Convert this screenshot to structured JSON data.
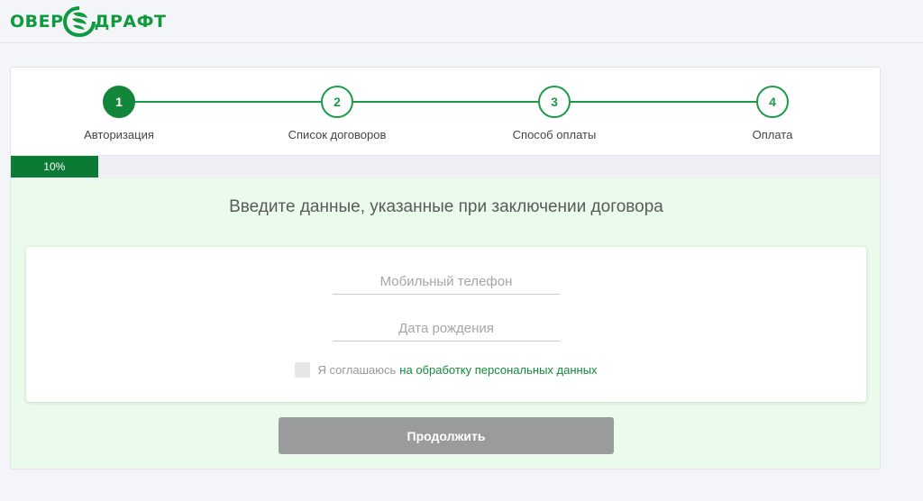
{
  "header": {
    "logo_left": "ОВЕР",
    "logo_right": "ДРАФТ",
    "brand_color": "#0f9a3e"
  },
  "stepper": {
    "steps": [
      {
        "number": "1",
        "label": "Авторизация",
        "active": true
      },
      {
        "number": "2",
        "label": "Список договоров",
        "active": false
      },
      {
        "number": "3",
        "label": "Способ оплаты",
        "active": false
      },
      {
        "number": "4",
        "label": "Оплата",
        "active": false
      }
    ]
  },
  "progress": {
    "value": 0.1,
    "label": "10%"
  },
  "form": {
    "title": "Введите данные, указанные при заключении договора",
    "phone_placeholder": "Мобильный телефон",
    "phone_value": "",
    "birthdate_placeholder": "Дата рождения",
    "birthdate_value": "",
    "agree_text": "Я соглашаюсь",
    "agree_link": "на обработку персональных данных",
    "agree_checked": false
  },
  "actions": {
    "submit_label": "Продолжить"
  }
}
